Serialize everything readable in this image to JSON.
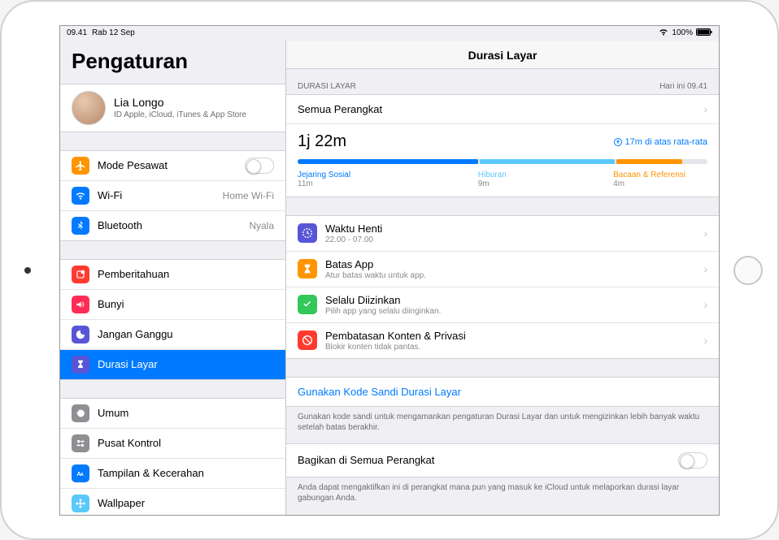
{
  "statusbar": {
    "time": "09.41",
    "date": "Rab 12 Sep",
    "battery": "100%"
  },
  "sidebar": {
    "title": "Pengaturan",
    "account": {
      "name": "Lia Longo",
      "subtitle": "ID Apple, iCloud, iTunes & App Store"
    },
    "group1": {
      "airplane": "Mode Pesawat",
      "wifi": "Wi-Fi",
      "wifi_value": "Home Wi-Fi",
      "bluetooth": "Bluetooth",
      "bluetooth_value": "Nyala"
    },
    "group2": {
      "notifications": "Pemberitahuan",
      "sounds": "Bunyi",
      "dnd": "Jangan Ganggu",
      "screentime": "Durasi Layar"
    },
    "group3": {
      "general": "Umum",
      "control": "Pusat Kontrol",
      "display": "Tampilan & Kecerahan",
      "wallpaper": "Wallpaper"
    }
  },
  "detail": {
    "title": "Durasi Layar",
    "section1_header": "DURASI LAYAR",
    "section1_right": "Hari ini 09.41",
    "all_devices": "Semua Perangkat",
    "total_time": "1j 22m",
    "above_average": "17m di atas rata-rata",
    "cat_social": "Jejaring Sosial",
    "cat_social_time": "11m",
    "cat_ent": "Hiburan",
    "cat_ent_time": "9m",
    "cat_read": "Bacaan & Referensi",
    "cat_read_time": "4m",
    "features": {
      "downtime_title": "Waktu Henti",
      "downtime_sub": "22.00 - 07.00",
      "applimits_title": "Batas App",
      "applimits_sub": "Atur batas waktu untuk app.",
      "allowed_title": "Selalu Diizinkan",
      "allowed_sub": "Pilih app yang selalu diinginkan.",
      "restrict_title": "Pembatasan Konten & Privasi",
      "restrict_sub": "Blokir konten tidak pantas."
    },
    "passcode_link": "Gunakan Kode Sandi Durasi Layar",
    "passcode_footer": "Gunakan kode sandi untuk mengamankan pengaturan Durasi Layar dan untuk mengizinkan lebih banyak waktu setelah batas berakhir.",
    "share_title": "Bagikan di Semua Perangkat",
    "share_footer": "Anda dapat mengaktifkan ini di perangkat mana pun yang masuk ke iCloud untuk melaporkan durasi layar gabungan Anda."
  },
  "colors": {
    "airplane": "#ff9500",
    "wifi": "#007aff",
    "bluetooth": "#007aff",
    "notifications": "#ff3b30",
    "sounds": "#ff2d55",
    "dnd": "#5856d6",
    "screentime": "#5856d6",
    "general": "#8e8e93",
    "control": "#8e8e93",
    "display": "#007aff",
    "wallpaper": "#5ac8fa",
    "downtime": "#5856d6",
    "applimits": "#ff9500",
    "allowed": "#34c759",
    "restrict": "#ff3b30"
  }
}
